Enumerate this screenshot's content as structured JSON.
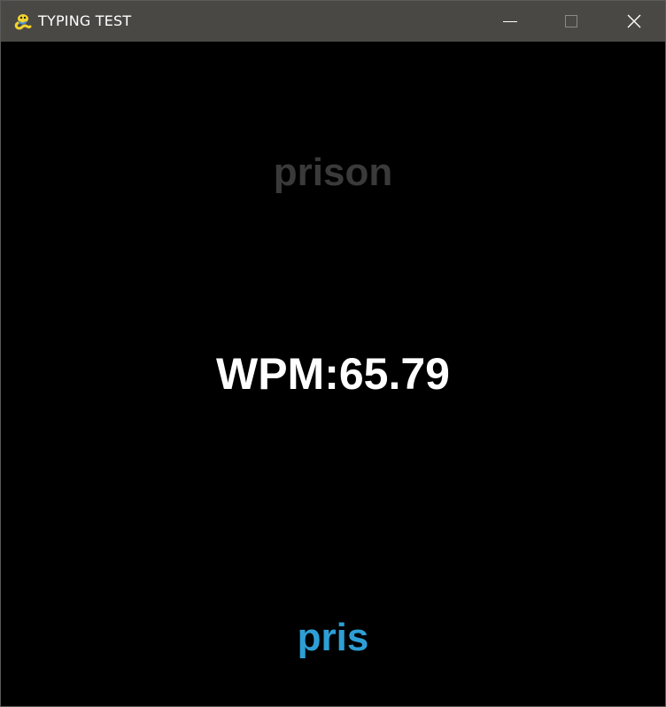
{
  "window": {
    "title": "TYPING TEST",
    "icon": "pygame-snake-icon",
    "controls": {
      "minimize": "minimize-icon",
      "maximize": "maximize-icon",
      "close": "close-icon"
    }
  },
  "game": {
    "target_word": "prison",
    "wpm_text": "WPM:65.79",
    "typed_text": "pris",
    "colors": {
      "background": "#000000",
      "target_word": "#3a3a3a",
      "wpm_text": "#ffffff",
      "typed_text": "#2e9fd6"
    }
  }
}
